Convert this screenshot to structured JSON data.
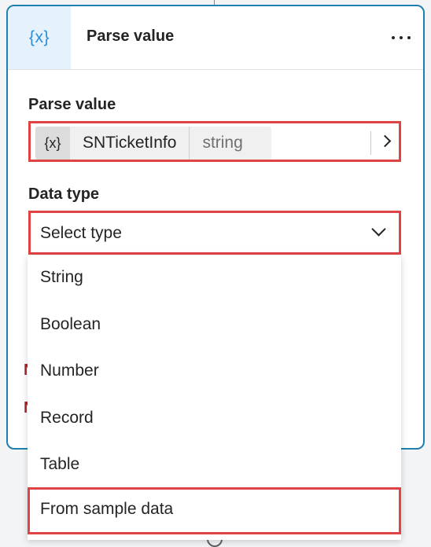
{
  "header": {
    "icon_glyph": "{x}",
    "icon_name": "variable-icon",
    "title": "Parse value",
    "more_icon": "more-horizontal-icon"
  },
  "parse_value": {
    "label": "Parse value",
    "variable": {
      "icon_glyph": "{x}",
      "name": "SNTicketInfo",
      "type": "string"
    },
    "expand_icon": "chevron-right-icon"
  },
  "data_type": {
    "label": "Data type",
    "placeholder": "Select type",
    "options": [
      "String",
      "Boolean",
      "Number",
      "Record",
      "Table",
      "From sample data"
    ],
    "highlighted_option": "From sample data"
  },
  "colors": {
    "accent": "#1f7fae",
    "icon_blue": "#2b8ed6",
    "highlight_red": "#e04343",
    "error_red": "#a4262c"
  }
}
